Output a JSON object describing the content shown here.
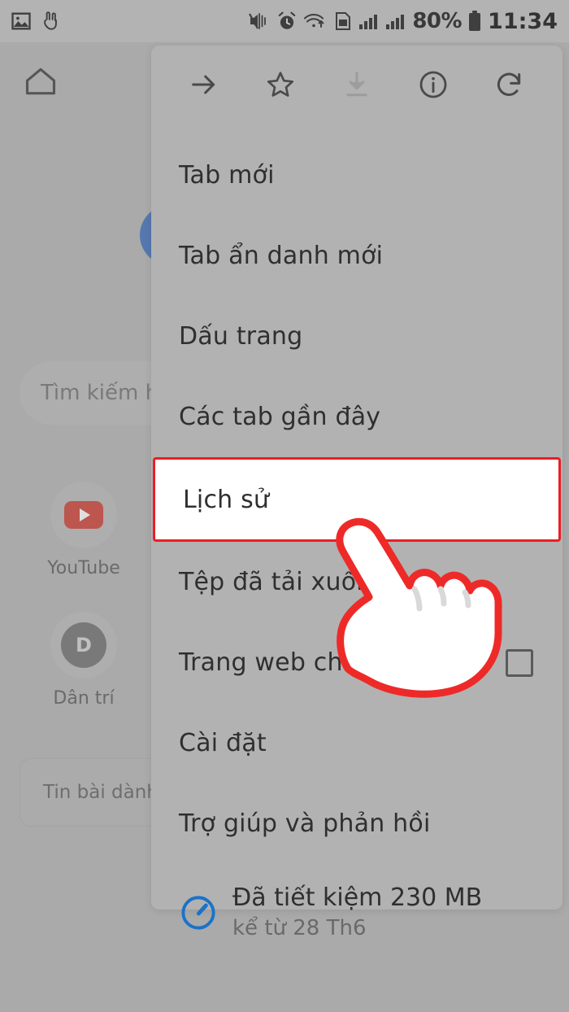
{
  "statusbar": {
    "left_icons": [
      "image-icon",
      "peace-hand-icon"
    ],
    "right_icons": [
      "mute-vibrate-icon",
      "alarm-icon",
      "wifi-transfer-icon",
      "sim-card-icon",
      "signal-bars-1-icon",
      "signal-bars-2-icon"
    ],
    "battery_percent": "80%",
    "battery_icon": "battery-icon",
    "clock": "11:34"
  },
  "background_page": {
    "home_icon": "home-icon",
    "google_logo": "google-logo",
    "search_placeholder": "Tìm kiếm h",
    "shortcuts": [
      {
        "label": "YouTube",
        "icon": "youtube-icon"
      },
      {
        "label": "Dân trí",
        "icon": "dantri-icon",
        "initial": "D"
      }
    ],
    "news_card_label": "Tin bài dành c"
  },
  "menu": {
    "toolbar_icons": [
      {
        "name": "forward-arrow-icon",
        "enabled": true
      },
      {
        "name": "star-bookmark-icon",
        "enabled": true
      },
      {
        "name": "download-icon",
        "enabled": false
      },
      {
        "name": "info-circle-icon",
        "enabled": true
      },
      {
        "name": "reload-icon",
        "enabled": true
      }
    ],
    "items": [
      {
        "label": "Tab mới",
        "highlight": false,
        "checkbox": false
      },
      {
        "label": "Tab ẩn danh mới",
        "highlight": false,
        "checkbox": false
      },
      {
        "label": "Dấu trang",
        "highlight": false,
        "checkbox": false
      },
      {
        "label": "Các tab gần đây",
        "highlight": false,
        "checkbox": false
      },
      {
        "label": "Lịch sử",
        "highlight": true,
        "checkbox": false
      },
      {
        "label": "Tệp đã tải xuống",
        "highlight": false,
        "checkbox": false
      },
      {
        "label": "Trang web cho má",
        "highlight": false,
        "checkbox": true
      },
      {
        "label": "Cài đặt",
        "highlight": false,
        "checkbox": false
      },
      {
        "label": "Trợ giúp và phản hồi",
        "highlight": false,
        "checkbox": false
      }
    ],
    "data_saver": {
      "icon": "speedometer-icon",
      "title": "Đã tiết kiệm 230 MB",
      "subtitle": "kể từ 28 Th6"
    }
  },
  "cursor": {
    "icon": "pointing-hand-cursor"
  },
  "colors": {
    "scrim_gray": "#b3b3b3",
    "menu_gray": "#b2b2b2",
    "highlight_red": "#ee1c24",
    "highlight_bg": "#ffffff",
    "youtube_red": "#cf3b32",
    "google_blue": "#3a6cba",
    "data_saver_blue": "#1a73c8",
    "text_dark": "#2f2f2f"
  }
}
